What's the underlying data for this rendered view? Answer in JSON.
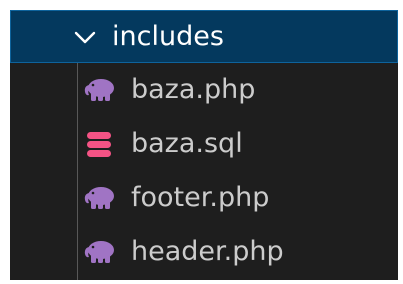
{
  "explorer": {
    "folder": {
      "name": "includes",
      "icon": "chevron-down-icon",
      "expanded": true
    },
    "files": [
      {
        "name": "baza.php",
        "icon": "php-elephant-icon"
      },
      {
        "name": "baza.sql",
        "icon": "database-icon"
      },
      {
        "name": "footer.php",
        "icon": "php-elephant-icon"
      },
      {
        "name": "header.php",
        "icon": "php-elephant-icon"
      }
    ]
  },
  "colors": {
    "background": "#1e1e1e",
    "selection": "#04395e",
    "selection_border": "#0e639c",
    "text": "#cccccc",
    "php_icon": "#a074c4",
    "sql_icon": "#f55385"
  }
}
